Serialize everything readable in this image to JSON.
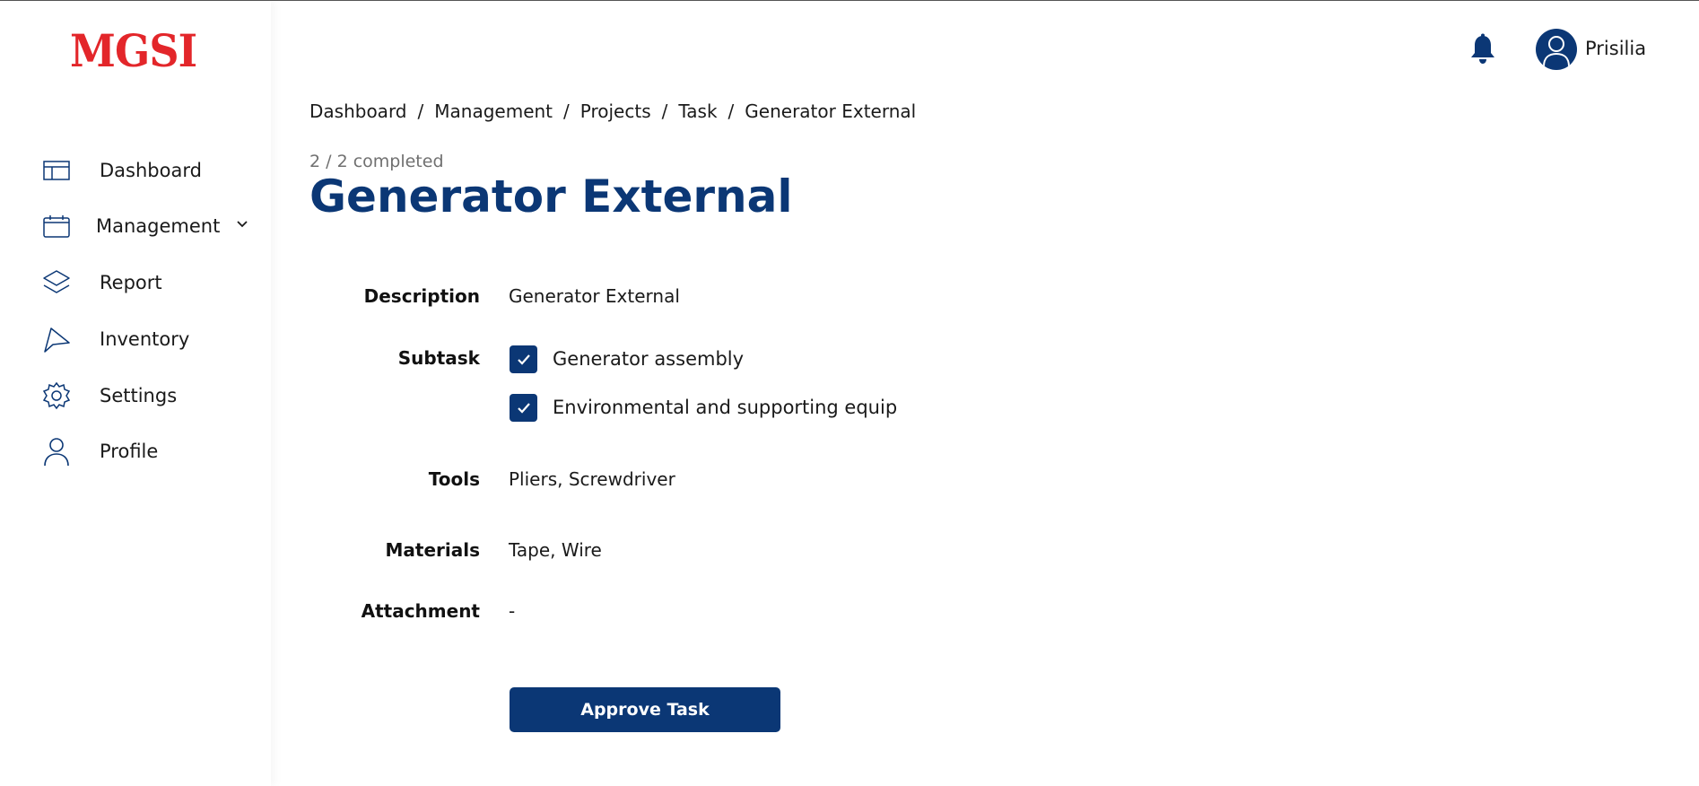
{
  "brand": {
    "logo_text": "MGSI",
    "logo_color": "#e3262a"
  },
  "sidebar": {
    "items": [
      {
        "label": "Dashboard",
        "icon": "layout-icon"
      },
      {
        "label": "Management",
        "icon": "calendar-box-icon",
        "has_submenu": true
      },
      {
        "label": "Report",
        "icon": "layers-icon"
      },
      {
        "label": "Inventory",
        "icon": "pen-tool-icon"
      },
      {
        "label": "Settings",
        "icon": "gear-icon"
      },
      {
        "label": "Profile",
        "icon": "user-icon"
      }
    ]
  },
  "topbar": {
    "notification_icon": "bell-icon",
    "username": "Prisilia"
  },
  "breadcrumb": [
    "Dashboard",
    "Management",
    "Projects",
    "Task",
    "Generator External"
  ],
  "task": {
    "progress_text": "2 / 2 completed",
    "title": "Generator External",
    "description_label": "Description",
    "description": "Generator External",
    "subtask_label": "Subtask",
    "subtasks": [
      {
        "label": "Generator assembly",
        "checked": true
      },
      {
        "label": "Environmental and supporting equip",
        "checked": true
      }
    ],
    "tools_label": "Tools",
    "tools": "Pliers, Screwdriver",
    "materials_label": "Materials",
    "materials": "Tape, Wire",
    "attachment_label": "Attachment",
    "attachment": "-",
    "approve_label": "Approve Task"
  },
  "colors": {
    "primary": "#0b3775",
    "accent": "#e3262a"
  }
}
